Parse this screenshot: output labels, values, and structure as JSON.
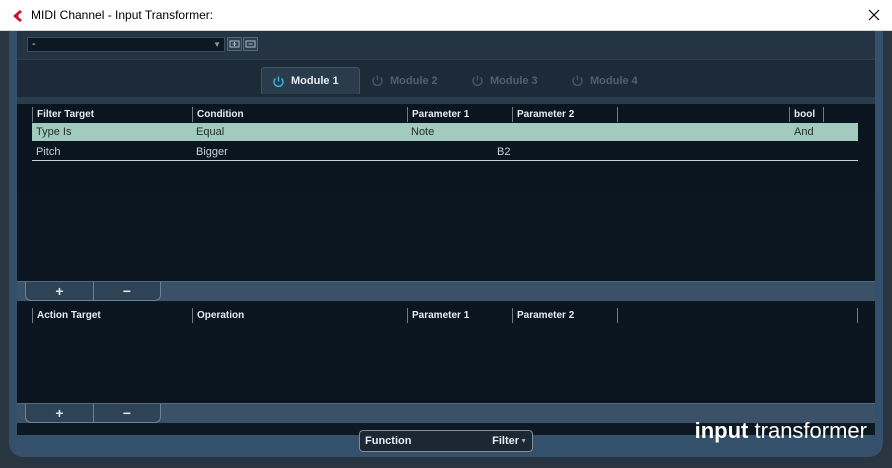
{
  "window": {
    "title": "MIDI Channel - Input Transformer:",
    "accent": "#c8102e"
  },
  "preset": {
    "value": "-"
  },
  "modules": [
    {
      "label": "Module 1",
      "active": true
    },
    {
      "label": "Module 2",
      "active": false
    },
    {
      "label": "Module 3",
      "active": false
    },
    {
      "label": "Module 4",
      "active": false
    }
  ],
  "filter_table": {
    "headers": [
      "Filter Target",
      "Condition",
      "Parameter 1",
      "Parameter 2",
      "",
      "bool"
    ],
    "rows": [
      {
        "target": "Type Is",
        "condition": "Equal",
        "param1": "Note",
        "param2": "",
        "bool": "And",
        "selected": true
      },
      {
        "target": "Pitch",
        "condition": "Bigger",
        "param1": "",
        "param2": "B2",
        "bool": "",
        "selected": false
      }
    ],
    "selected_color": "#a2cbbd"
  },
  "filter_buttons": {
    "add": "+",
    "remove": "−"
  },
  "action_table": {
    "headers": [
      "Action Target",
      "Operation",
      "Parameter 1",
      "Parameter 2",
      ""
    ]
  },
  "action_buttons": {
    "add": "+",
    "remove": "−"
  },
  "function": {
    "label": "Function",
    "value": "Filter"
  },
  "brand": {
    "bold": "input",
    "rest": "transformer"
  }
}
